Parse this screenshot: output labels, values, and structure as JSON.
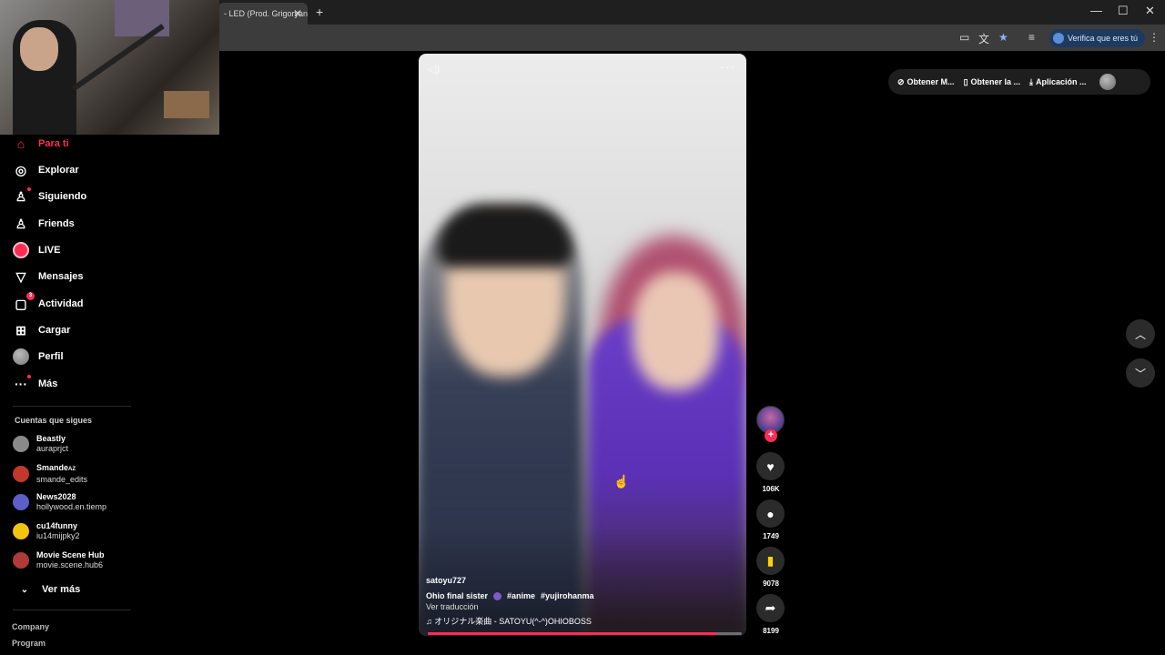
{
  "browser": {
    "tab_title": "- LED (Prod. Grigoryan",
    "tab_close": "✕",
    "new_tab": "+",
    "minimize": "—",
    "maximize": "☐",
    "close": "✕",
    "verify_label": "Verifica que eres tú",
    "menu": "⋮"
  },
  "sidebar": {
    "items": [
      {
        "label": "Para ti",
        "icon": "home-icon"
      },
      {
        "label": "Explorar",
        "icon": "compass-icon"
      },
      {
        "label": "Siguiendo",
        "icon": "following-icon"
      },
      {
        "label": "Friends",
        "icon": "friends-icon"
      },
      {
        "label": "LIVE",
        "icon": "live-icon"
      },
      {
        "label": "Mensajes",
        "icon": "send-icon"
      },
      {
        "label": "Actividad",
        "icon": "activity-icon",
        "badge": "3"
      },
      {
        "label": "Cargar",
        "icon": "upload-icon"
      },
      {
        "label": "Perfil",
        "icon": "avatar"
      },
      {
        "label": "Más",
        "icon": "more-icon"
      }
    ],
    "following_title": "Cuentas que sigues",
    "following": [
      {
        "name": "Beastly",
        "handle": "auraprjct",
        "color": "#7a7a7a"
      },
      {
        "name": "Smande",
        "name_suffix": "AZ",
        "handle": "smande_edits",
        "color": "#c0392b"
      },
      {
        "name": "News2028",
        "handle": "hollywood.en.tiemp",
        "color": "#5b5fc7"
      },
      {
        "name": "cu14funny",
        "handle": "iu14mijpky2",
        "color": "#f1c40f"
      },
      {
        "name": "Movie Scene Hub",
        "handle": "movie.scene.hub6",
        "color": "#b03a3a"
      }
    ],
    "see_more": "Ver más",
    "footer": [
      "Company",
      "Program"
    ]
  },
  "video": {
    "username": "satoyu727",
    "caption": "Ohio final sister",
    "hashtags": [
      "#anime",
      "#yujirohanma"
    ],
    "translate": "Ver traducción",
    "music": "♫ オリジナル楽曲 - SATOYU(^-^)OHIOBOSS",
    "progress": 0.92,
    "more": "···"
  },
  "actions": {
    "likes": "106K",
    "comments": "1749",
    "saves": "9078",
    "shares": "8199"
  },
  "top_pill": {
    "items": [
      "Obtener M...",
      "Obtener la ...",
      "Aplicación ..."
    ]
  },
  "colors": {
    "accent": "#fe2c55",
    "save": "#ffd200"
  }
}
